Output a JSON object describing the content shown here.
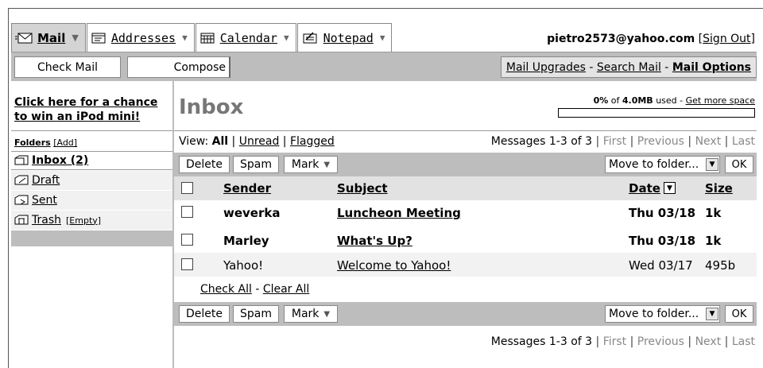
{
  "tabs": [
    {
      "label": "Mail",
      "icon": "envelope-icon",
      "active": true
    },
    {
      "label": "Addresses",
      "icon": "address-book-icon",
      "active": false
    },
    {
      "label": "Calendar",
      "icon": "calendar-icon",
      "active": false
    },
    {
      "label": "Notepad",
      "icon": "notepad-icon",
      "active": false
    }
  ],
  "user": {
    "email": "pietro2573@yahoo.com",
    "sign_out": "Sign Out"
  },
  "actionbar": {
    "check_mail": "Check Mail",
    "compose": "Compose",
    "mail_upgrades": "Mail Upgrades",
    "search_mail": "Search Mail",
    "mail_options": "Mail Options"
  },
  "sidebar": {
    "promo_line1": "Click here for a chance",
    "promo_line2": "to win an iPod mini!",
    "folders_label": "Folders",
    "add_label": "[Add]",
    "folders": [
      {
        "name": "Inbox (2)",
        "icon": "inbox-folder-icon"
      },
      {
        "name": "Draft",
        "icon": "draft-folder-icon"
      },
      {
        "name": "Sent",
        "icon": "sent-folder-icon"
      },
      {
        "name": "Trash",
        "icon": "trash-folder-icon",
        "extra": "[Empty]"
      }
    ]
  },
  "main": {
    "title": "Inbox",
    "quota": {
      "pct": "0%",
      "of": "of",
      "size": "4.0MB",
      "used": "used -",
      "get_more": "Get more space",
      "fill_fraction": 0
    },
    "view": {
      "label": "View:",
      "all": "All",
      "unread": "Unread",
      "flagged": "Flagged"
    },
    "pager": {
      "count": "Messages 1-3 of 3",
      "first": "First",
      "previous": "Previous",
      "next": "Next",
      "last": "Last"
    },
    "toolbar": {
      "delete": "Delete",
      "spam": "Spam",
      "mark": "Mark",
      "move": "Move to folder...",
      "ok": "OK"
    },
    "columns": {
      "sender": "Sender",
      "subject": "Subject",
      "date": "Date",
      "size": "Size"
    },
    "messages": [
      {
        "sender": "weverka",
        "subject": "Luncheon Meeting",
        "date": "Thu 03/18",
        "size": "1k",
        "unread": true
      },
      {
        "sender": "Marley",
        "subject": "What's Up?",
        "date": "Thu 03/18",
        "size": "1k",
        "unread": true
      },
      {
        "sender": "Yahoo!",
        "subject": "Welcome to Yahoo!",
        "date": "Wed 03/17",
        "size": "495b",
        "unread": false
      }
    ],
    "check_all": "Check All",
    "clear_all": "Clear All"
  }
}
